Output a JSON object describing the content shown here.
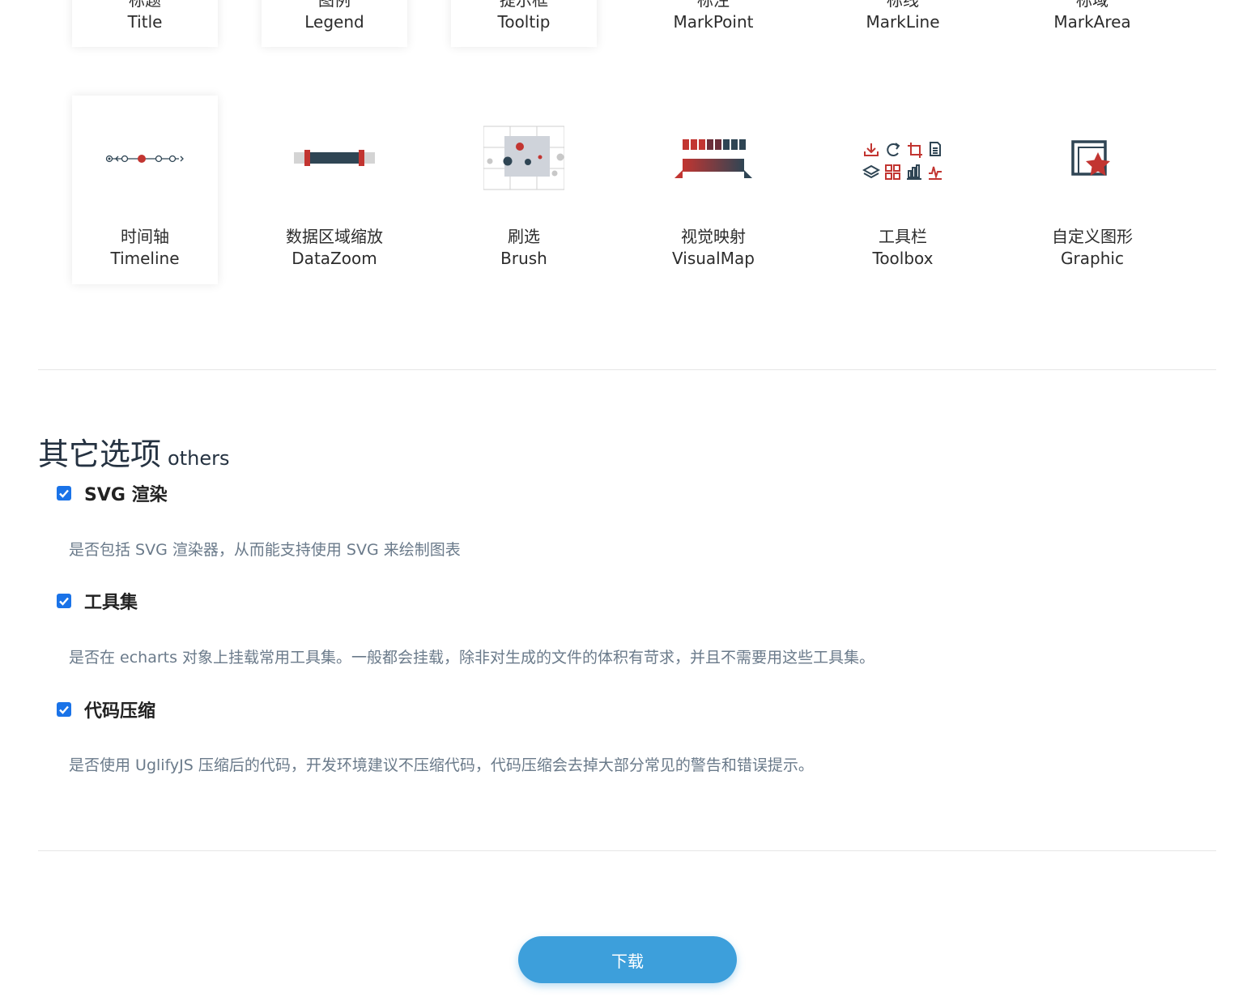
{
  "components_row1": [
    {
      "cn": "标题",
      "en": "Title",
      "selected": true
    },
    {
      "cn": "图例",
      "en": "Legend",
      "selected": true
    },
    {
      "cn": "提示框",
      "en": "Tooltip",
      "selected": true
    },
    {
      "cn": "标注",
      "en": "MarkPoint",
      "selected": false
    },
    {
      "cn": "标线",
      "en": "MarkLine",
      "selected": false
    },
    {
      "cn": "标域",
      "en": "MarkArea",
      "selected": false
    }
  ],
  "components_row2": [
    {
      "cn": "时间轴",
      "en": "Timeline",
      "selected": true,
      "icon": "timeline-icon"
    },
    {
      "cn": "数据区域缩放",
      "en": "DataZoom",
      "selected": false,
      "icon": "datazoom-icon"
    },
    {
      "cn": "刷选",
      "en": "Brush",
      "selected": false,
      "icon": "brush-icon"
    },
    {
      "cn": "视觉映射",
      "en": "VisualMap",
      "selected": false,
      "icon": "visualmap-icon"
    },
    {
      "cn": "工具栏",
      "en": "Toolbox",
      "selected": false,
      "icon": "toolbox-icon"
    },
    {
      "cn": "自定义图形",
      "en": "Graphic",
      "selected": false,
      "icon": "graphic-icon"
    }
  ],
  "others": {
    "title_zh": "其它选项",
    "title_en": "others",
    "options": [
      {
        "label": "SVG 渲染",
        "checked": true,
        "desc": "是否包括 SVG 渲染器，从而能支持使用 SVG 来绘制图表"
      },
      {
        "label": "工具集",
        "checked": true,
        "desc": "是否在 echarts 对象上挂载常用工具集。一般都会挂载，除非对生成的文件的体积有苛求，并且不需要用这些工具集。"
      },
      {
        "label": "代码压缩",
        "checked": true,
        "desc": "是否使用 UglifyJS 压缩后的代码，开发环境建议不压缩代码，代码压缩会去掉大部分常见的警告和错误提示。"
      }
    ]
  },
  "download_label": "下载",
  "colors": {
    "accent_red": "#c23531",
    "dark_navy": "#2f4554",
    "button_blue": "#3d9fdb"
  }
}
